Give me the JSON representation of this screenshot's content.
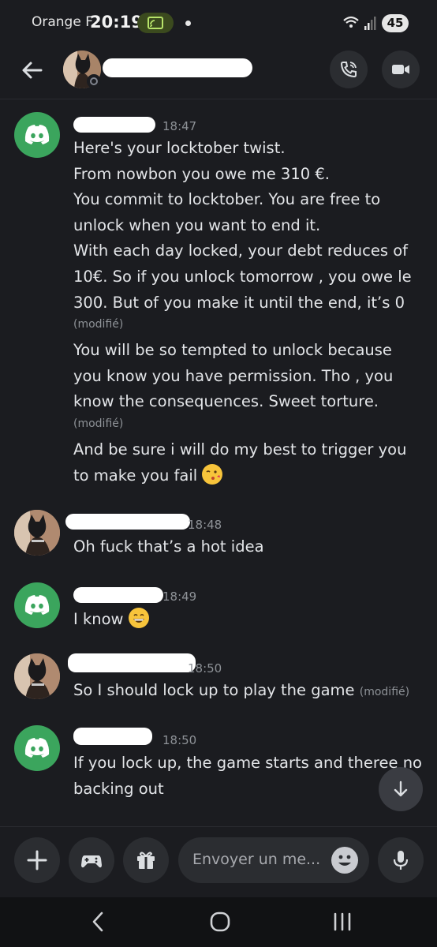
{
  "status_bar": {
    "carrier": "Orange F",
    "clock": "20:19",
    "battery": "45",
    "network": "5"
  },
  "header": {
    "contact_name": ""
  },
  "messages": [
    {
      "time": "18:47",
      "paragraphs": [
        {
          "lines": [
            "Here's your locktober twist.",
            "From nowbon you owe me 310 €.",
            "You commit to locktober. You are free to",
            "unlock when you want to end it.",
            "With each day locked, your debt reduces of",
            "10€. So if you unlock tomorrow , you owe le",
            "300. But of you make it until the end, it’s 0"
          ],
          "edited": "(modifié)"
        },
        {
          "lines": [
            "You will be so tempted to unlock because",
            "you know you have permission.  Tho , you",
            "know the consequences.  Sweet torture."
          ],
          "edited": "(modifié)"
        },
        {
          "lines": [
            "And be sure i will do my best to trigger you",
            "to make you fail"
          ],
          "emoji": "kissing-face"
        }
      ]
    },
    {
      "time": "18:48",
      "text": "Oh fuck that’s a hot idea"
    },
    {
      "time": "18:49",
      "text": "I know",
      "emoji": "grinning-face"
    },
    {
      "time": "18:50",
      "text": "So I should lock up to play the game",
      "edited": "(modifié)"
    },
    {
      "time": "18:50",
      "lines": [
        "If you lock up, the game starts and theree no",
        "backing out"
      ]
    }
  ],
  "composer": {
    "placeholder": "Envoyer un me..."
  },
  "colors": {
    "background": "#1b1c20",
    "discord_green": "#3ba55d",
    "button": "#2b2d31",
    "muted": "#8e9297"
  }
}
